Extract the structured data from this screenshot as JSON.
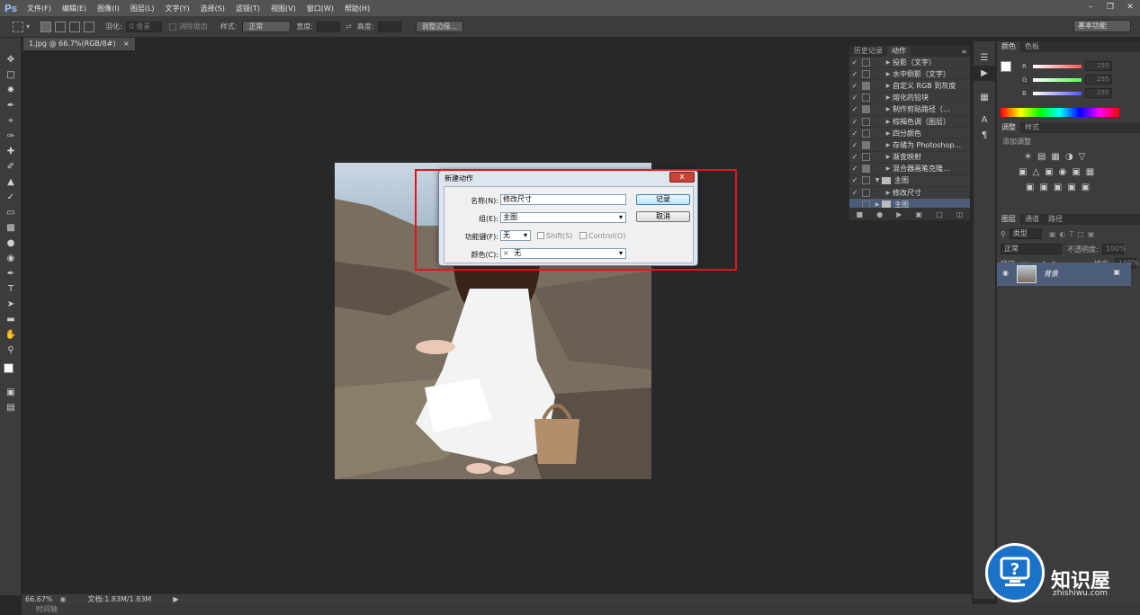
{
  "app": {
    "logo": "Ps"
  },
  "menu": [
    "文件(F)",
    "编辑(E)",
    "图像(I)",
    "图层(L)",
    "文字(Y)",
    "选择(S)",
    "滤镜(T)",
    "视图(V)",
    "窗口(W)",
    "帮助(H)"
  ],
  "options": {
    "feather_label": "羽化:",
    "feather_value": "0 像素",
    "antialias_label": "消除锯齿",
    "style_label": "样式:",
    "style_value": "正常",
    "width_label": "宽度:",
    "height_label": "高度:",
    "refine_edge": "调整边缘...",
    "workspace": "基本功能"
  },
  "document": {
    "tab_title": "1.jpg @ 66.7%(RGB/8#)"
  },
  "actions_panel": {
    "tabs": [
      "历史记录",
      "动作"
    ],
    "items": [
      {
        "name": "投影（文字）",
        "checked": true,
        "dialog": false,
        "indent": 1
      },
      {
        "name": "水中倒影（文字）",
        "checked": true,
        "dialog": false,
        "indent": 1
      },
      {
        "name": "自定义 RGB 到灰度",
        "checked": true,
        "dialog": true,
        "indent": 1
      },
      {
        "name": "熔化的铅块",
        "checked": true,
        "dialog": false,
        "indent": 1
      },
      {
        "name": "制作剪贴路径（...",
        "checked": true,
        "dialog": true,
        "indent": 1
      },
      {
        "name": "棕褐色调（图层）",
        "checked": true,
        "dialog": false,
        "indent": 1
      },
      {
        "name": "四分颜色",
        "checked": true,
        "dialog": false,
        "indent": 1
      },
      {
        "name": "存储为 Photoshop...",
        "checked": true,
        "dialog": true,
        "indent": 1
      },
      {
        "name": "渐变映射",
        "checked": true,
        "dialog": false,
        "indent": 1
      },
      {
        "name": "混合器画笔克隆...",
        "checked": true,
        "dialog": true,
        "indent": 1
      },
      {
        "name": "主图",
        "checked": true,
        "dialog": false,
        "indent": 0,
        "folder": true,
        "open": true
      },
      {
        "name": "修改尺寸",
        "checked": true,
        "dialog": false,
        "indent": 1
      },
      {
        "name": "主图",
        "checked": false,
        "dialog": false,
        "indent": 0,
        "folder": true,
        "open": false,
        "selected": true
      }
    ]
  },
  "dialog": {
    "title": "新建动作",
    "close": "x",
    "name_label": "名称(N):",
    "name_value": "修改尺寸",
    "group_label": "组(E):",
    "group_value": "主图",
    "fkey_label": "功能键(F):",
    "fkey_value": "无",
    "shift_label": "Shift(S)",
    "control_label": "Control(O)",
    "color_label": "颜色(C):",
    "color_value": "无",
    "color_x": "×",
    "record_button": "记录",
    "cancel_button": "取消"
  },
  "color_panel": {
    "tabs": [
      "颜色",
      "色板"
    ],
    "channels": [
      {
        "label": "R",
        "value": "255",
        "color": "#ff5555"
      },
      {
        "label": "G",
        "value": "255",
        "color": "#55ff55"
      },
      {
        "label": "B",
        "value": "255",
        "color": "#5555ff"
      }
    ]
  },
  "adjust_panel": {
    "tabs": [
      "调整",
      "样式"
    ],
    "add_label": "添加调整"
  },
  "layers_panel": {
    "tabs": [
      "图层",
      "通道",
      "路径"
    ],
    "kind_label": "类型",
    "blend_mode": "正常",
    "opacity_label": "不透明度:",
    "opacity_value": "100%",
    "lock_label": "锁定:",
    "fill_label": "填充:",
    "fill_value": "100%",
    "layer_name": "背景"
  },
  "status": {
    "zoom": "66.67%",
    "doc_info": "文档:1.83M/1.83M",
    "timeline": "时间轴"
  },
  "watermark": {
    "text": "知识屋",
    "sub": "zhishiwu.com"
  },
  "colors": {
    "accent": "#e0141d",
    "selection": "#4b5d78",
    "ps_blue": "#8bbde8"
  }
}
